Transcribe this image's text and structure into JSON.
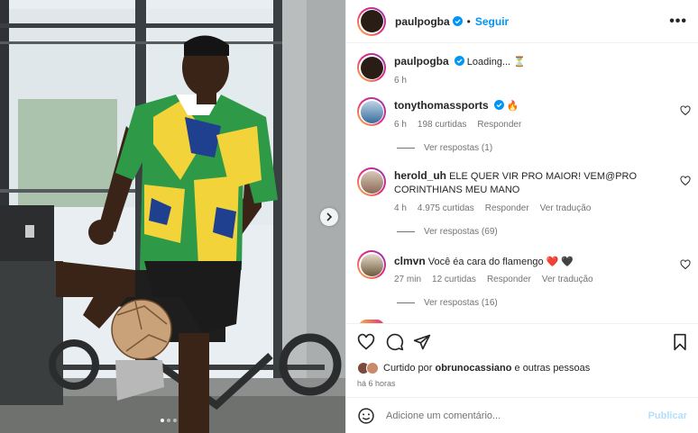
{
  "post": {
    "author": "paulpogba",
    "follow_label": "Seguir",
    "separator": "•",
    "more_label": "•••"
  },
  "caption": {
    "username": "paulpogba",
    "text": "Loading... ⏳",
    "time": "6 h"
  },
  "comments": [
    {
      "username": "tonythomassports",
      "verified": true,
      "text": "🔥",
      "time": "6 h",
      "likes": "198 curtidas",
      "reply": "Responder",
      "translate": "",
      "replies": "Ver respostas (1)"
    },
    {
      "username": "herold_uh",
      "verified": false,
      "text": "ELE QUER VIR PRO MAIOR! VEM@PRO CORINTHIANS MEU MANO",
      "time": "4 h",
      "likes": "4.975 curtidas",
      "reply": "Responder",
      "translate": "Ver tradução",
      "replies": "Ver respostas (69)"
    },
    {
      "username": "clmvn",
      "verified": false,
      "text": "Você éa cara do flamengo ❤️ 🖤",
      "time": "27 min",
      "likes": "12 curtidas",
      "reply": "Responder",
      "translate": "Ver tradução",
      "replies": "Ver respostas (16)"
    }
  ],
  "likes_line": {
    "prefix": "Curtido por",
    "user": "obrunocassiano",
    "suffix": "e outras pessoas"
  },
  "posted_ago": "há 6 horas",
  "composer": {
    "placeholder": "Adicione um comentário...",
    "publish_label": "Publicar"
  },
  "colors": {
    "accent": "#0095f6",
    "publish_disabled": "#b2dffc",
    "jersey_green": "#2e9a48",
    "jersey_yellow": "#f2d33a",
    "jersey_blue": "#1f3f8f"
  },
  "icons": [
    "heart-icon",
    "comment-icon",
    "share-icon",
    "bookmark-icon",
    "emoji-icon",
    "verified-icon",
    "chevron-right-icon"
  ]
}
